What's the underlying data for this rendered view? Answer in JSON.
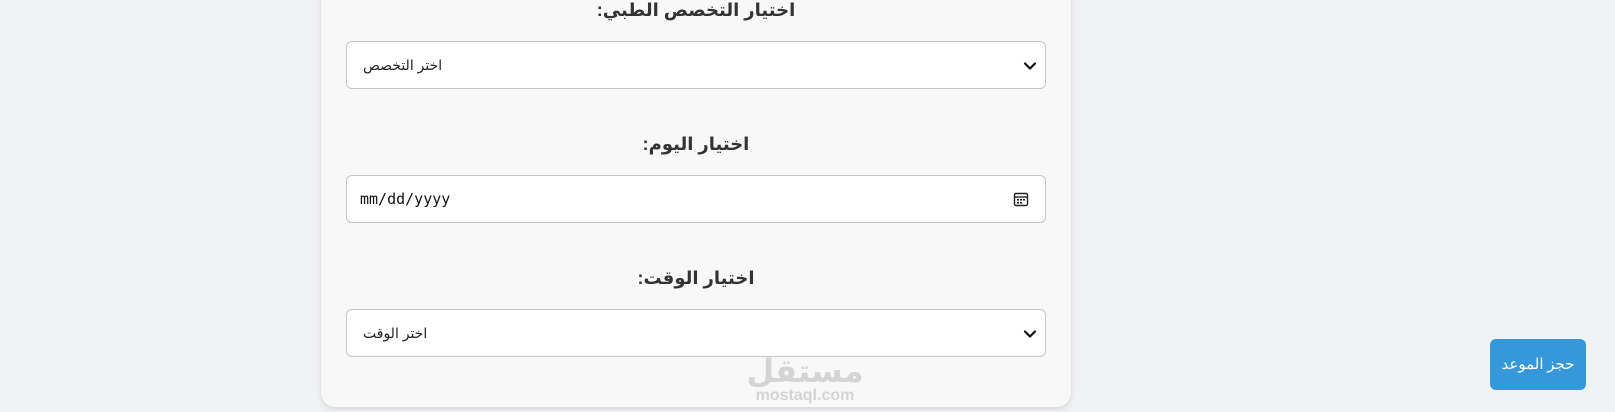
{
  "form": {
    "specialty": {
      "label": "اختيار التخصص الطبي:",
      "selected": "اختر التخصص"
    },
    "day": {
      "label": "اختيار اليوم:",
      "placeholder": "mm/dd/yyyy"
    },
    "time": {
      "label": "اختيار الوقت:",
      "selected": "اختر الوقت"
    }
  },
  "watermark": {
    "arabic": "مستقل",
    "latin": "mostaql.com"
  },
  "book_button": {
    "label": "حجز الموعد",
    "color": "#3498db"
  }
}
